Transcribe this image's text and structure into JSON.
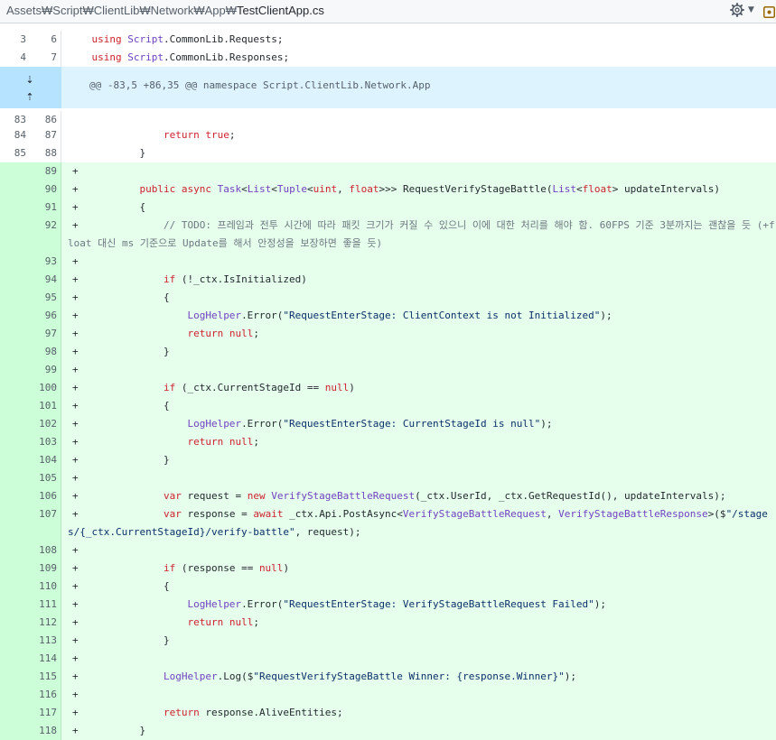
{
  "header": {
    "path_prefix": "Assets₩Script₩ClientLib₩Network₩App₩",
    "file_name": "TestClientApp.cs"
  },
  "icons": {
    "settings": "gear-icon",
    "caret": "chevron-down-icon",
    "view": "view-file-icon"
  },
  "colors": {
    "added_bg": "#e6ffec",
    "added_gutter": "#ccffd8",
    "hunk_bg": "#ddf4ff",
    "keyword": "#cf222e",
    "type": "#6f42c1"
  },
  "hunk": {
    "text": "@@ -83,5 +86,35 @@ namespace Script.ClientLib.Network.App"
  },
  "lines": [
    {
      "old": "3",
      "new": "6",
      "marker": "",
      "code": "    using Script.CommonLib.Requests;"
    },
    {
      "old": "4",
      "new": "7",
      "marker": "",
      "code": "    using Script.CommonLib.Responses;"
    },
    {
      "old": "83",
      "new": "86",
      "marker": "",
      "code": ""
    },
    {
      "old": "84",
      "new": "87",
      "marker": "",
      "code": "                return true;"
    },
    {
      "old": "85",
      "new": "88",
      "marker": "",
      "code": "            }"
    },
    {
      "old": "",
      "new": "89",
      "marker": "+",
      "code": ""
    },
    {
      "old": "",
      "new": "90",
      "marker": "+",
      "code": "            public async Task<List<Tuple<uint, float>>> RequestVerifyStageBattle(List<float> updateIntervals)"
    },
    {
      "old": "",
      "new": "91",
      "marker": "+",
      "code": "            {"
    },
    {
      "old": "",
      "new": "92",
      "marker": "+",
      "code": "                // TODO: 프레임과 전투 시간에 따라 패킷 크기가 커질 수 있으니 이에 대한 처리를 해야 함. 60FPS 기준 3분까지는 괜찮을 듯 (+float 대신 ms 기준으로 Update를 해서 안정성을 보장하면 좋을 듯)"
    },
    {
      "old": "",
      "new": "93",
      "marker": "+",
      "code": ""
    },
    {
      "old": "",
      "new": "94",
      "marker": "+",
      "code": "                if (!_ctx.IsInitialized)"
    },
    {
      "old": "",
      "new": "95",
      "marker": "+",
      "code": "                {"
    },
    {
      "old": "",
      "new": "96",
      "marker": "+",
      "code": "                    LogHelper.Error(\"RequestEnterStage: ClientContext is not Initialized\");"
    },
    {
      "old": "",
      "new": "97",
      "marker": "+",
      "code": "                    return null;"
    },
    {
      "old": "",
      "new": "98",
      "marker": "+",
      "code": "                }"
    },
    {
      "old": "",
      "new": "99",
      "marker": "+",
      "code": ""
    },
    {
      "old": "",
      "new": "100",
      "marker": "+",
      "code": "                if (_ctx.CurrentStageId == null)"
    },
    {
      "old": "",
      "new": "101",
      "marker": "+",
      "code": "                {"
    },
    {
      "old": "",
      "new": "102",
      "marker": "+",
      "code": "                    LogHelper.Error(\"RequestEnterStage: CurrentStageId is null\");"
    },
    {
      "old": "",
      "new": "103",
      "marker": "+",
      "code": "                    return null;"
    },
    {
      "old": "",
      "new": "104",
      "marker": "+",
      "code": "                }"
    },
    {
      "old": "",
      "new": "105",
      "marker": "+",
      "code": ""
    },
    {
      "old": "",
      "new": "106",
      "marker": "+",
      "code": "                var request = new VerifyStageBattleRequest(_ctx.UserId, _ctx.GetRequestId(), updateIntervals);"
    },
    {
      "old": "",
      "new": "107",
      "marker": "+",
      "code": "                var response = await _ctx.Api.PostAsync<VerifyStageBattleRequest, VerifyStageBattleResponse>($\"/stages/{_ctx.CurrentStageId}/verify-battle\", request);"
    },
    {
      "old": "",
      "new": "108",
      "marker": "+",
      "code": ""
    },
    {
      "old": "",
      "new": "109",
      "marker": "+",
      "code": "                if (response == null)"
    },
    {
      "old": "",
      "new": "110",
      "marker": "+",
      "code": "                {"
    },
    {
      "old": "",
      "new": "111",
      "marker": "+",
      "code": "                    LogHelper.Error(\"RequestEnterStage: VerifyStageBattleRequest Failed\");"
    },
    {
      "old": "",
      "new": "112",
      "marker": "+",
      "code": "                    return null;"
    },
    {
      "old": "",
      "new": "113",
      "marker": "+",
      "code": "                }"
    },
    {
      "old": "",
      "new": "114",
      "marker": "+",
      "code": ""
    },
    {
      "old": "",
      "new": "115",
      "marker": "+",
      "code": "                LogHelper.Log($\"RequestVerifyStageBattle Winner: {response.Winner}\");"
    },
    {
      "old": "",
      "new": "116",
      "marker": "+",
      "code": ""
    },
    {
      "old": "",
      "new": "117",
      "marker": "+",
      "code": "                return response.AliveEntities;"
    },
    {
      "old": "",
      "new": "118",
      "marker": "+",
      "code": "            }"
    }
  ]
}
